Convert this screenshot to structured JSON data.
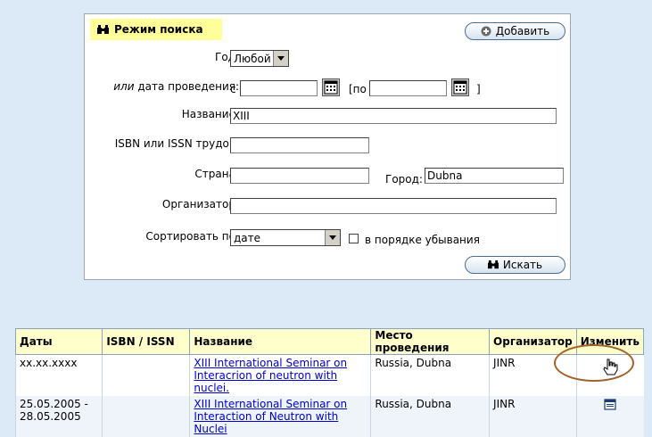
{
  "search": {
    "mode_title": "Режим поиска",
    "add_button": "Добавить",
    "search_button": "Искать",
    "year_label": "Год:",
    "year_value": "Любой",
    "date_label_prefix": "или",
    "date_label_rest": " дата проведения:",
    "date_from_prefix": "с",
    "date_to_open": "[по",
    "date_to_close": "]",
    "date_from_value": "",
    "date_to_value": "",
    "title_label": "Название:",
    "title_value": "XIII",
    "isbn_label": "ISBN или ISSN трудов:",
    "isbn_value": "",
    "country_label": "Страна:",
    "country_value": "",
    "city_label": "Город:",
    "city_value": "Dubna",
    "organizer_label": "Организатор:",
    "organizer_value": "",
    "sort_label": "Сортировать по:",
    "sort_value": "дате",
    "desc_label": "в порядке убывания"
  },
  "results": {
    "columns": [
      "Даты",
      "ISBN / ISSN",
      "Название",
      "Место проведения",
      "Организатор",
      "Изменить"
    ],
    "rows": [
      {
        "dates": "xx.xx.xxxx",
        "isbn": "",
        "title_line1": "XIII International Seminar on",
        "title_line2": "Interacrion of neutron with nuclei.",
        "place": "Russia, Dubna",
        "organizer": "JINR"
      },
      {
        "dates": "25.05.2005 -",
        "dates2": "28.05.2005",
        "isbn": "",
        "title_line1": "XIII International Seminar on",
        "title_line2": "Interaction of Neutron with Nuclei",
        "place": "Russia, Dubna",
        "organizer": "JINR"
      }
    ]
  },
  "colors": {
    "badge": "#ffff99",
    "header": "#ffffcc",
    "link": "#0000cc",
    "ring": "#a0622a"
  },
  "icons": [
    "binoculars-icon",
    "plus-circle-icon",
    "calendar-icon",
    "edit-icon",
    "hand-cursor-icon"
  ]
}
